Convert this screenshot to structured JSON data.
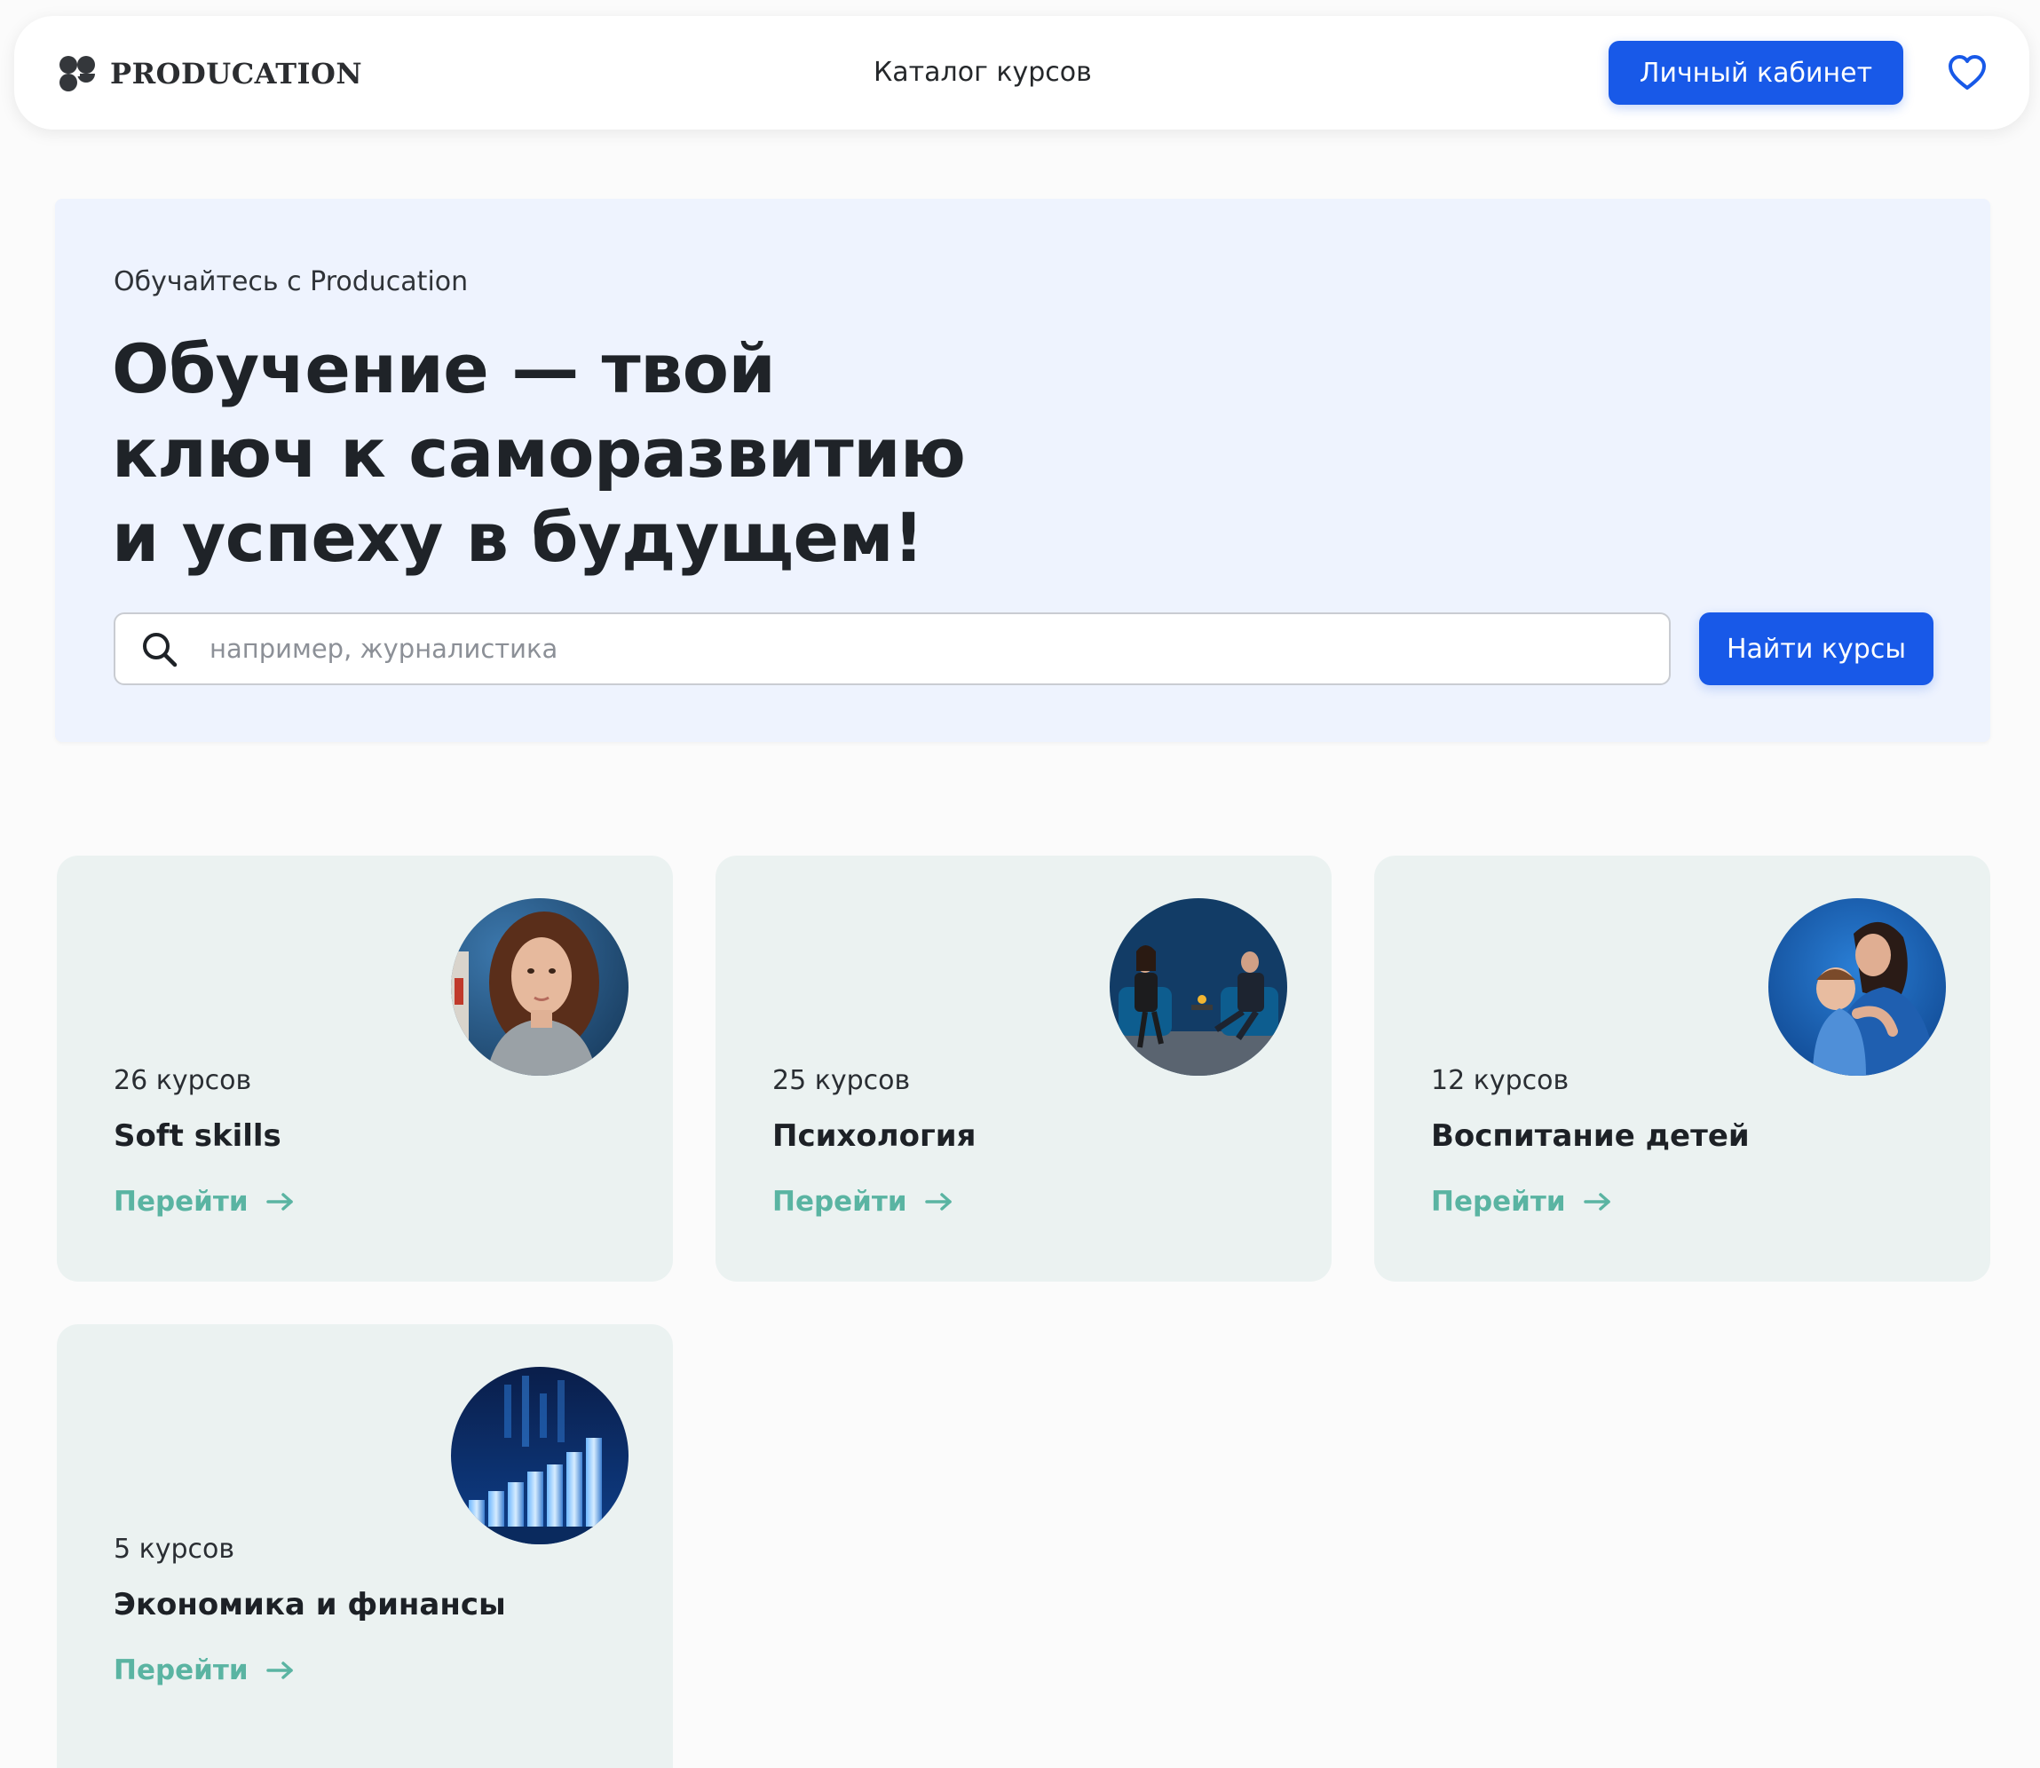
{
  "header": {
    "logo_text": "PRODUCATION",
    "nav_catalog": "Каталог курсов",
    "cabinet_button": "Личный кабинет",
    "favorites_icon": "heart-icon"
  },
  "hero": {
    "kicker": "Обучайтесь с Producation",
    "title": "Обучение — твой ключ к саморазвитию и успеху в будущем!",
    "search": {
      "placeholder": "например, журналистика",
      "value": "",
      "icon": "search-icon"
    },
    "find_button": "Найти курсы"
  },
  "categories": [
    {
      "count": "26 курсов",
      "title": "Soft skills",
      "link": "Перейти",
      "image": "woman-portrait"
    },
    {
      "count": "25 курсов",
      "title": "Психология",
      "link": "Перейти",
      "image": "therapy-session"
    },
    {
      "count": "12 курсов",
      "title": "Воспитание детей",
      "link": "Перейти",
      "image": "mother-with-child"
    },
    {
      "count": "5 курсов",
      "title": "Экономика и финансы",
      "link": "Перейти",
      "image": "coin-stacks"
    }
  ],
  "colors": {
    "primary": "#1859e8",
    "hero_bg": "#eef3fe",
    "card_bg": "#ebf2f1",
    "link": "#5ab4a2"
  }
}
